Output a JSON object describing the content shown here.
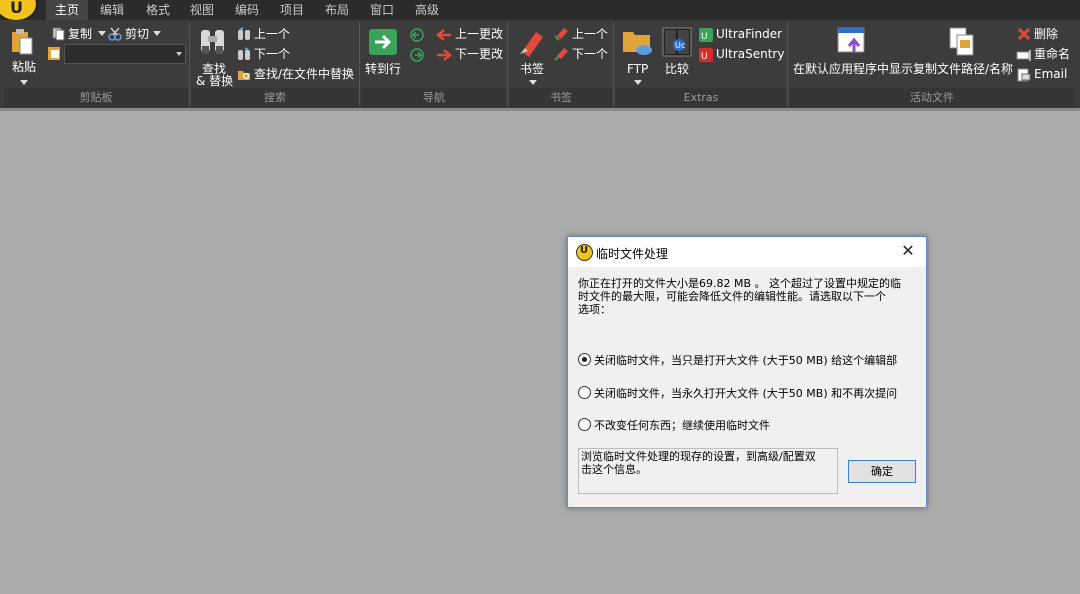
{
  "menu": {
    "tabs": [
      "主页",
      "编辑",
      "格式",
      "视图",
      "编码",
      "项目",
      "布局",
      "窗口",
      "高级"
    ],
    "active_index": 0
  },
  "ribbon": {
    "clipboard": {
      "paste": "粘贴",
      "copy": "复制",
      "cut": "剪切",
      "group": "剪贴板"
    },
    "search": {
      "find_replace_line1": "查找",
      "find_replace_line2": "& 替换",
      "prev": "上一个",
      "next": "下一个",
      "find_in_files": "查找/在文件中替换",
      "group": "搜索"
    },
    "navigation": {
      "goto": "转到行",
      "prev_change": "上一更改",
      "next_change": "下一更改",
      "group": "导航"
    },
    "bookmarks": {
      "bookmark": "书签",
      "prev": "上一个",
      "next": "下一个",
      "group": "书签"
    },
    "extras": {
      "ftp": "FTP",
      "compare": "比较",
      "ultrafinder": "UltraFinder",
      "ultrasentry": "UltraSentry",
      "group": "Extras"
    },
    "active_file": {
      "show_in_default_app": "在默认应用程序中显示",
      "copy_path": "复制文件路径/名称",
      "delete": "删除",
      "rename": "重命名",
      "email": "Email",
      "group": "活动文件"
    }
  },
  "dialog": {
    "title": "临时文件处理",
    "message_line1": "你正在打开的文件大小是69.82 MB 。 这个超过了设置中规定的临",
    "message_line2": "时文件的最大限，可能会降低文件的编辑性能。请选取以下一个",
    "message_line3": "选项：",
    "options": [
      {
        "label": "关闭临时文件，当只是打开大文件 (大于50 MB) 给这个编辑部",
        "checked": true
      },
      {
        "label": "关闭临时文件，当永久打开大文件 (大于50 MB) 和不再次提问",
        "checked": false
      },
      {
        "label": "不改变任何东西；继续使用临时文件",
        "checked": false
      }
    ],
    "info_line1": "浏览临时文件处理的现存的设置，到高级/配置双",
    "info_line2": "击这个信息。",
    "ok_label": "确定"
  },
  "colors": {
    "menubar": "#2b2b2b",
    "ribbon": "#3c3c3c",
    "workspace": "#ababab",
    "accent": "#3c7fd8"
  }
}
